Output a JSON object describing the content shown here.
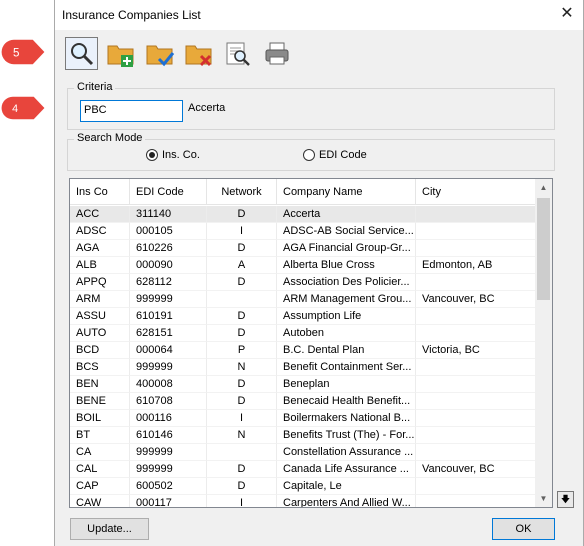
{
  "window": {
    "title": "Insurance Companies List"
  },
  "toolbar": {
    "buttons": [
      {
        "name": "search",
        "icon": "magnifier-icon"
      },
      {
        "name": "add",
        "icon": "folder-add-icon"
      },
      {
        "name": "edit",
        "icon": "folder-check-icon"
      },
      {
        "name": "delete",
        "icon": "folder-delete-icon"
      },
      {
        "name": "preview",
        "icon": "document-search-icon"
      },
      {
        "name": "print",
        "icon": "printer-icon"
      }
    ]
  },
  "criteria": {
    "label": "Criteria",
    "value": "PBC",
    "match": "Accerta"
  },
  "search_mode": {
    "label": "Search Mode",
    "options": [
      {
        "label": "Ins. Co.",
        "selected": true
      },
      {
        "label": "EDI Code",
        "selected": false
      }
    ]
  },
  "table": {
    "columns": [
      "Ins Co",
      "EDI Code",
      "Network",
      "Company Name",
      "City"
    ],
    "rows": [
      [
        "ACC",
        "311140",
        "D",
        "Accerta",
        ""
      ],
      [
        "ADSC",
        "000105",
        "I",
        "ADSC-AB Social Service...",
        ""
      ],
      [
        "AGA",
        "610226",
        "D",
        "AGA Financial Group-Gr...",
        ""
      ],
      [
        "ALB",
        "000090",
        "A",
        "Alberta Blue Cross",
        "Edmonton, AB"
      ],
      [
        "APPQ",
        "628112",
        "D",
        "Association Des Policier...",
        ""
      ],
      [
        "ARM",
        "999999",
        "",
        "ARM Management Grou...",
        "Vancouver, BC"
      ],
      [
        "ASSU",
        "610191",
        "D",
        "Assumption Life",
        ""
      ],
      [
        "AUTO",
        "628151",
        "D",
        "Autoben",
        ""
      ],
      [
        "BCD",
        "000064",
        "P",
        "B.C. Dental Plan",
        "Victoria, BC"
      ],
      [
        "BCS",
        "999999",
        "N",
        "Benefit Containment Ser...",
        ""
      ],
      [
        "BEN",
        "400008",
        "D",
        "Beneplan",
        ""
      ],
      [
        "BENE",
        "610708",
        "D",
        "Benecaid Health Benefit...",
        ""
      ],
      [
        "BOIL",
        "000116",
        "I",
        "Boilermakers National B...",
        ""
      ],
      [
        "BT",
        "610146",
        "N",
        "Benefits Trust (The) - For...",
        ""
      ],
      [
        "CA",
        "999999",
        "",
        "Constellation Assurance ...",
        ""
      ],
      [
        "CAL",
        "999999",
        "D",
        "Canada Life Assurance ...",
        "Vancouver, BC"
      ],
      [
        "CAP",
        "600502",
        "D",
        "Capitale, Le",
        ""
      ],
      [
        "CAW",
        "000117",
        "I",
        "Carpenters And Allied W...",
        ""
      ]
    ]
  },
  "footer": {
    "update_label": "Update...",
    "ok_label": "OK"
  },
  "annotations": {
    "badge_top": "5",
    "badge_bottom": "4",
    "color": "#e8453c"
  },
  "colors": {
    "accent": "#0078d7"
  }
}
